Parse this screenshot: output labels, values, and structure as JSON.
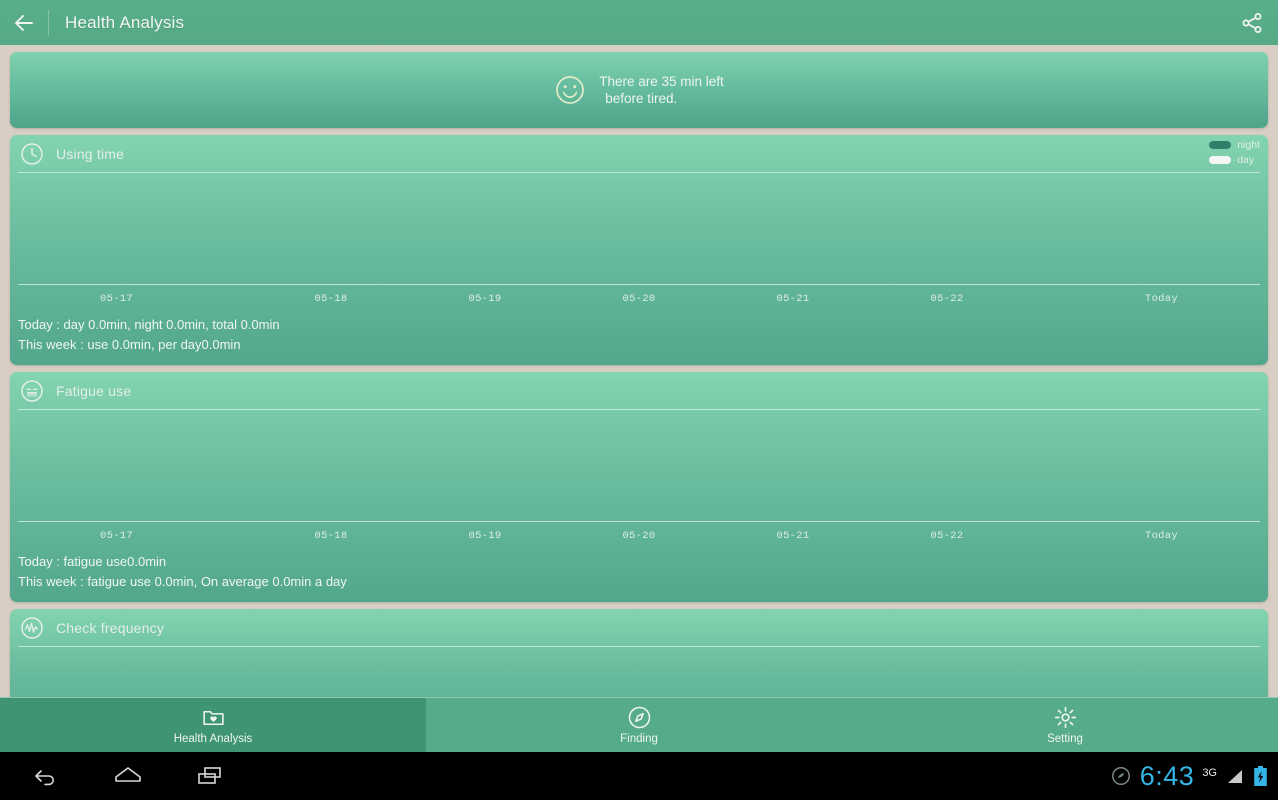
{
  "appbar": {
    "title": "Health Analysis",
    "back_icon": "arrow-left-icon",
    "share_icon": "share-icon"
  },
  "banner": {
    "icon": "smiley-face-icon",
    "line1": "There are 35 min left",
    "line2": "before tired."
  },
  "cards": {
    "using_time": {
      "icon": "clock-icon",
      "title": "Using time",
      "legend": [
        {
          "label": "night",
          "color": "#2f7f6a"
        },
        {
          "label": "day",
          "color": "#f2f7f4"
        }
      ],
      "summary_line1": "Today : day 0.0min, night 0.0min, total 0.0min",
      "summary_line2": "This week : use 0.0min, per day0.0min"
    },
    "fatigue_use": {
      "icon": "tired-face-icon",
      "title": "Fatigue use",
      "summary_line1": "Today : fatigue use0.0min",
      "summary_line2": "This week : fatigue use 0.0min, On average 0.0min a day"
    },
    "check_frequency": {
      "icon": "pulse-wave-icon",
      "title": "Check frequency"
    }
  },
  "chart_data": [
    {
      "type": "bar",
      "title": "Using time",
      "categories": [
        "05-17",
        "05-18",
        "05-19",
        "05-20",
        "05-21",
        "05-22",
        "Today"
      ],
      "series": [
        {
          "name": "night",
          "values": [
            0,
            0,
            0,
            0,
            0,
            0,
            0
          ]
        },
        {
          "name": "day",
          "values": [
            0,
            0,
            0,
            0,
            0,
            0,
            0
          ]
        }
      ],
      "xlabel": "",
      "ylabel": "",
      "ylim": [
        0,
        0
      ],
      "grid": false,
      "legend_position": "top-right"
    },
    {
      "type": "bar",
      "title": "Fatigue use",
      "categories": [
        "05-17",
        "05-18",
        "05-19",
        "05-20",
        "05-21",
        "05-22",
        "Today"
      ],
      "values": [
        0,
        0,
        0,
        0,
        0,
        0,
        0
      ],
      "xlabel": "",
      "ylabel": "",
      "ylim": [
        0,
        0
      ],
      "grid": false
    },
    {
      "type": "bar",
      "title": "Check frequency",
      "categories": [],
      "values": [],
      "xlabel": "",
      "ylabel": "",
      "grid": false
    }
  ],
  "tabbar": {
    "tabs": [
      {
        "label": "Health Analysis",
        "icon": "folder-heart-icon",
        "active": true
      },
      {
        "label": "Finding",
        "icon": "compass-icon",
        "active": false
      },
      {
        "label": "Setting",
        "icon": "gear-icon",
        "active": false
      }
    ]
  },
  "systembar": {
    "back_icon": "android-back-icon",
    "home_icon": "android-home-icon",
    "recents_icon": "android-recents-icon",
    "notification_icon": "app-notification-icon",
    "clock": "6:43",
    "network": "3G",
    "signal_icon": "signal-bars-icon",
    "battery_icon": "battery-charging-icon"
  }
}
